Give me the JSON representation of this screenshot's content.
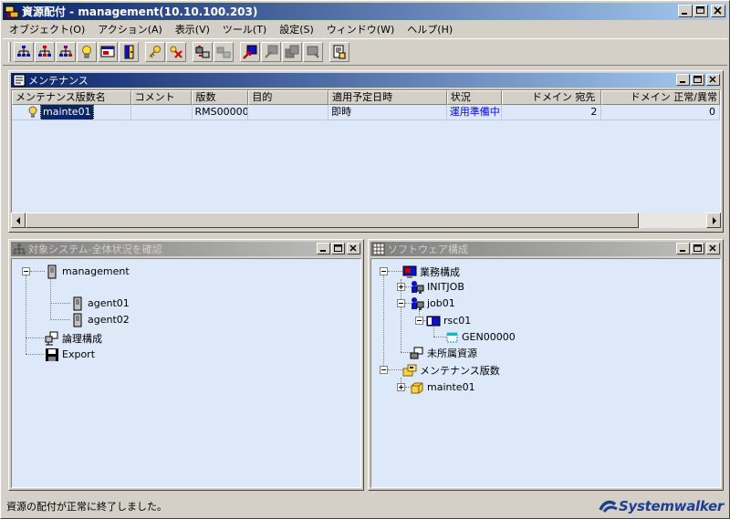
{
  "window": {
    "title": "資源配付 - management(10.10.100.203)"
  },
  "menu": [
    "オブジェクト(O)",
    "アクション(A)",
    "表示(V)",
    "ツール(T)",
    "設定(S)",
    "ウィンドウ(W)",
    "ヘルプ(H)"
  ],
  "toolbar": {
    "buttons": [
      "network-tree-icon",
      "network-tree-red-icon",
      "network-tree-purple-icon",
      "bulb-icon",
      "computer-window-icon",
      "door-exit-icon",
      "key-icon",
      "delete-x-icon",
      "transfer-icon",
      "transfer-disabled-icon",
      "deploy-icon",
      "restore-disabled-icon",
      "stack-disabled-icon",
      "monitor-disabled-icon",
      "report-icon"
    ]
  },
  "maintenance": {
    "title": "メンテナンス",
    "columns": [
      "メンテナンス版数名",
      "コメント",
      "版数",
      "目的",
      "適用予定日時",
      "状況",
      "ドメイン 宛先",
      "ドメイン 正常/異常"
    ],
    "rows": [
      {
        "name": "mainte01",
        "comment": "",
        "version": "RMS00000",
        "purpose": "",
        "schedule": "即時",
        "status": "運用準備中",
        "dest": "2",
        "result": "0"
      }
    ]
  },
  "system_pane": {
    "title": "対象システム-全体状況を確認",
    "root": "management",
    "agents": [
      "agent01",
      "agent02"
    ],
    "logical": "論理構成",
    "export": "Export"
  },
  "software_pane": {
    "title": "ソフトウェア構成",
    "business": "業務構成",
    "initjob": "INITJOB",
    "job": "job01",
    "rsc": "rsc01",
    "gen": "GEN00000",
    "unassigned": "未所属資源",
    "maint_versions": "メンテナンス版数",
    "mainte": "mainte01"
  },
  "status": {
    "message": "資源の配付が正常に終了しました。",
    "brand": "Systemwalker"
  },
  "colors": {
    "title_active": "#0a246a",
    "pane_bg": "#dde8f8",
    "status_blue": "#0000ff"
  }
}
